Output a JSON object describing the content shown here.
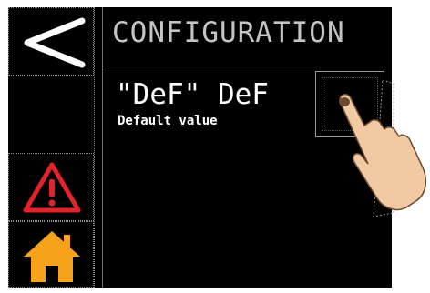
{
  "screen": {
    "title": "CONFIGURATION",
    "parameter_code": "\"DeF\" DeF",
    "parameter_description": "Default value",
    "value_display": ""
  },
  "buttons": {
    "back_icon": "back-arrow-icon",
    "alarm_icon": "warning-triangle-icon",
    "home_icon": "home-icon"
  },
  "colors": {
    "background": "#000000",
    "title_text": "#c4c4c4",
    "value_text": "#ffffff",
    "alarm_red": "#e3232b",
    "home_orange": "#f7a21b"
  }
}
